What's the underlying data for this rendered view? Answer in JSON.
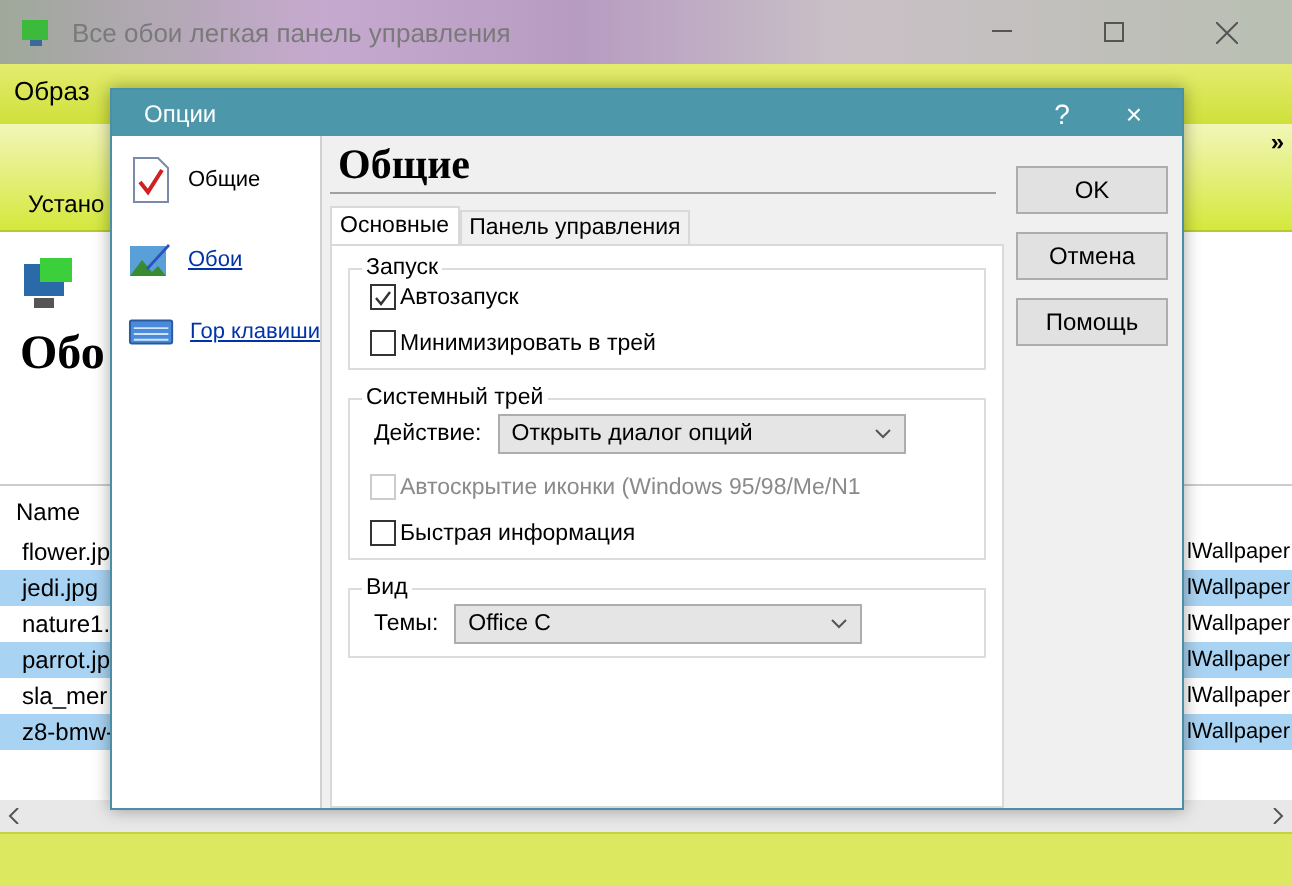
{
  "window": {
    "title": "Все обои легкая панель управления"
  },
  "menu": [
    "Образ"
  ],
  "toolbar": {
    "button": "Устано",
    "overflow": "»"
  },
  "header": {
    "title": "Обо"
  },
  "file_list": {
    "columns": [
      "Name"
    ],
    "rows": [
      {
        "name": "flower.jp",
        "column_2": "lWallpaper",
        "selected": false
      },
      {
        "name": "jedi.jpg",
        "column_2": "lWallpaper",
        "selected": true
      },
      {
        "name": "nature1.",
        "column_2": "lWallpaper",
        "selected": false
      },
      {
        "name": "parrot.jp",
        "column_2": "lWallpaper",
        "selected": true
      },
      {
        "name": "sla_mer",
        "column_2": "lWallpaper",
        "selected": false
      },
      {
        "name": "z8-bmw-",
        "column_2": "lWallpaper",
        "selected": true
      }
    ]
  },
  "dialog": {
    "title": "Опции",
    "help": "?",
    "close": "×",
    "nav": [
      {
        "label": "Общие",
        "selected": true
      },
      {
        "label": "Обои",
        "selected": false
      },
      {
        "label": "Гор клавиши",
        "selected": false
      }
    ],
    "heading": "Общие",
    "tabs": [
      {
        "label": "Основные",
        "selected": true
      },
      {
        "label": "Панель управления",
        "selected": false
      }
    ],
    "groups": [
      {
        "title": "Запуск",
        "items": [
          {
            "kind": "checkbox",
            "label": "Автозапуск",
            "checked": true,
            "disabled": false
          },
          {
            "kind": "checkbox",
            "label": "Минимизировать в трей",
            "checked": false,
            "disabled": false
          }
        ]
      },
      {
        "title": "Системный трей",
        "items": [
          {
            "kind": "select",
            "label": "Действие:",
            "value": "Открыть диалог опций"
          },
          {
            "kind": "checkbox",
            "label": "Автоскрытие иконки (Windows 95/98/Me/N1",
            "checked": false,
            "disabled": true
          },
          {
            "kind": "checkbox",
            "label": "Быстрая информация",
            "checked": false,
            "disabled": false
          }
        ]
      },
      {
        "title": "Вид",
        "items": [
          {
            "kind": "select",
            "label": "Темы:",
            "value": "Office C"
          }
        ]
      }
    ],
    "buttons": [
      "OK",
      "Отмена",
      "Помощь"
    ]
  }
}
